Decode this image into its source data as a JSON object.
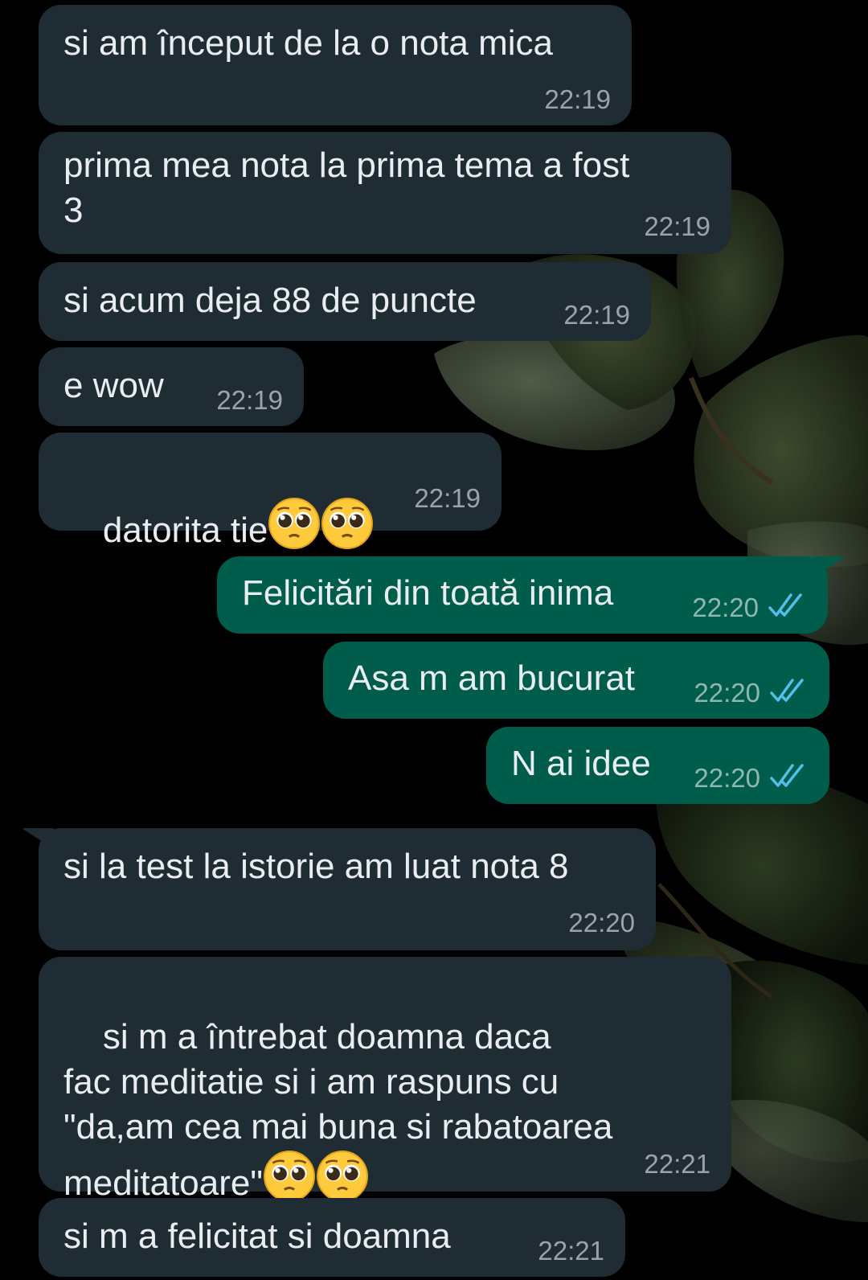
{
  "colors": {
    "background": "#000000",
    "incoming_bubble": "#1f2c34",
    "outgoing_bubble": "#005c4b",
    "message_text": "#e9edef",
    "read_ticks": "#53bdeb"
  },
  "messages": [
    {
      "direction": "in",
      "text": "si am început de la o nota mica",
      "time": "22:19"
    },
    {
      "direction": "in",
      "text": "prima mea nota la prima tema a fost\n3",
      "time": "22:19"
    },
    {
      "direction": "in",
      "text": "si acum deja 88 de puncte",
      "time": "22:19"
    },
    {
      "direction": "in",
      "text": "e wow",
      "time": "22:19"
    },
    {
      "direction": "in",
      "text": "datorita tie",
      "emojis": [
        "pleading-face-emoji",
        "pleading-face-emoji"
      ],
      "time": "22:19"
    },
    {
      "direction": "out",
      "text": "Felicitări din toată inima",
      "time": "22:20",
      "status": "read"
    },
    {
      "direction": "out",
      "text": "Asa m am bucurat",
      "time": "22:20",
      "status": "read"
    },
    {
      "direction": "out",
      "text": "N ai idee",
      "time": "22:20",
      "status": "read"
    },
    {
      "direction": "in",
      "text": "si la test la istorie am luat nota 8",
      "time": "22:20"
    },
    {
      "direction": "in",
      "text": "si m a întrebat doamna daca\nfac meditatie si i am raspuns cu\n\"da,am cea mai buna si rabatoarea\nmeditatoare\"",
      "emojis": [
        "pleading-face-emoji",
        "pleading-face-emoji"
      ],
      "time": "22:21"
    },
    {
      "direction": "in",
      "text": "si m a felicitat si doamna",
      "time": "22:21"
    }
  ]
}
